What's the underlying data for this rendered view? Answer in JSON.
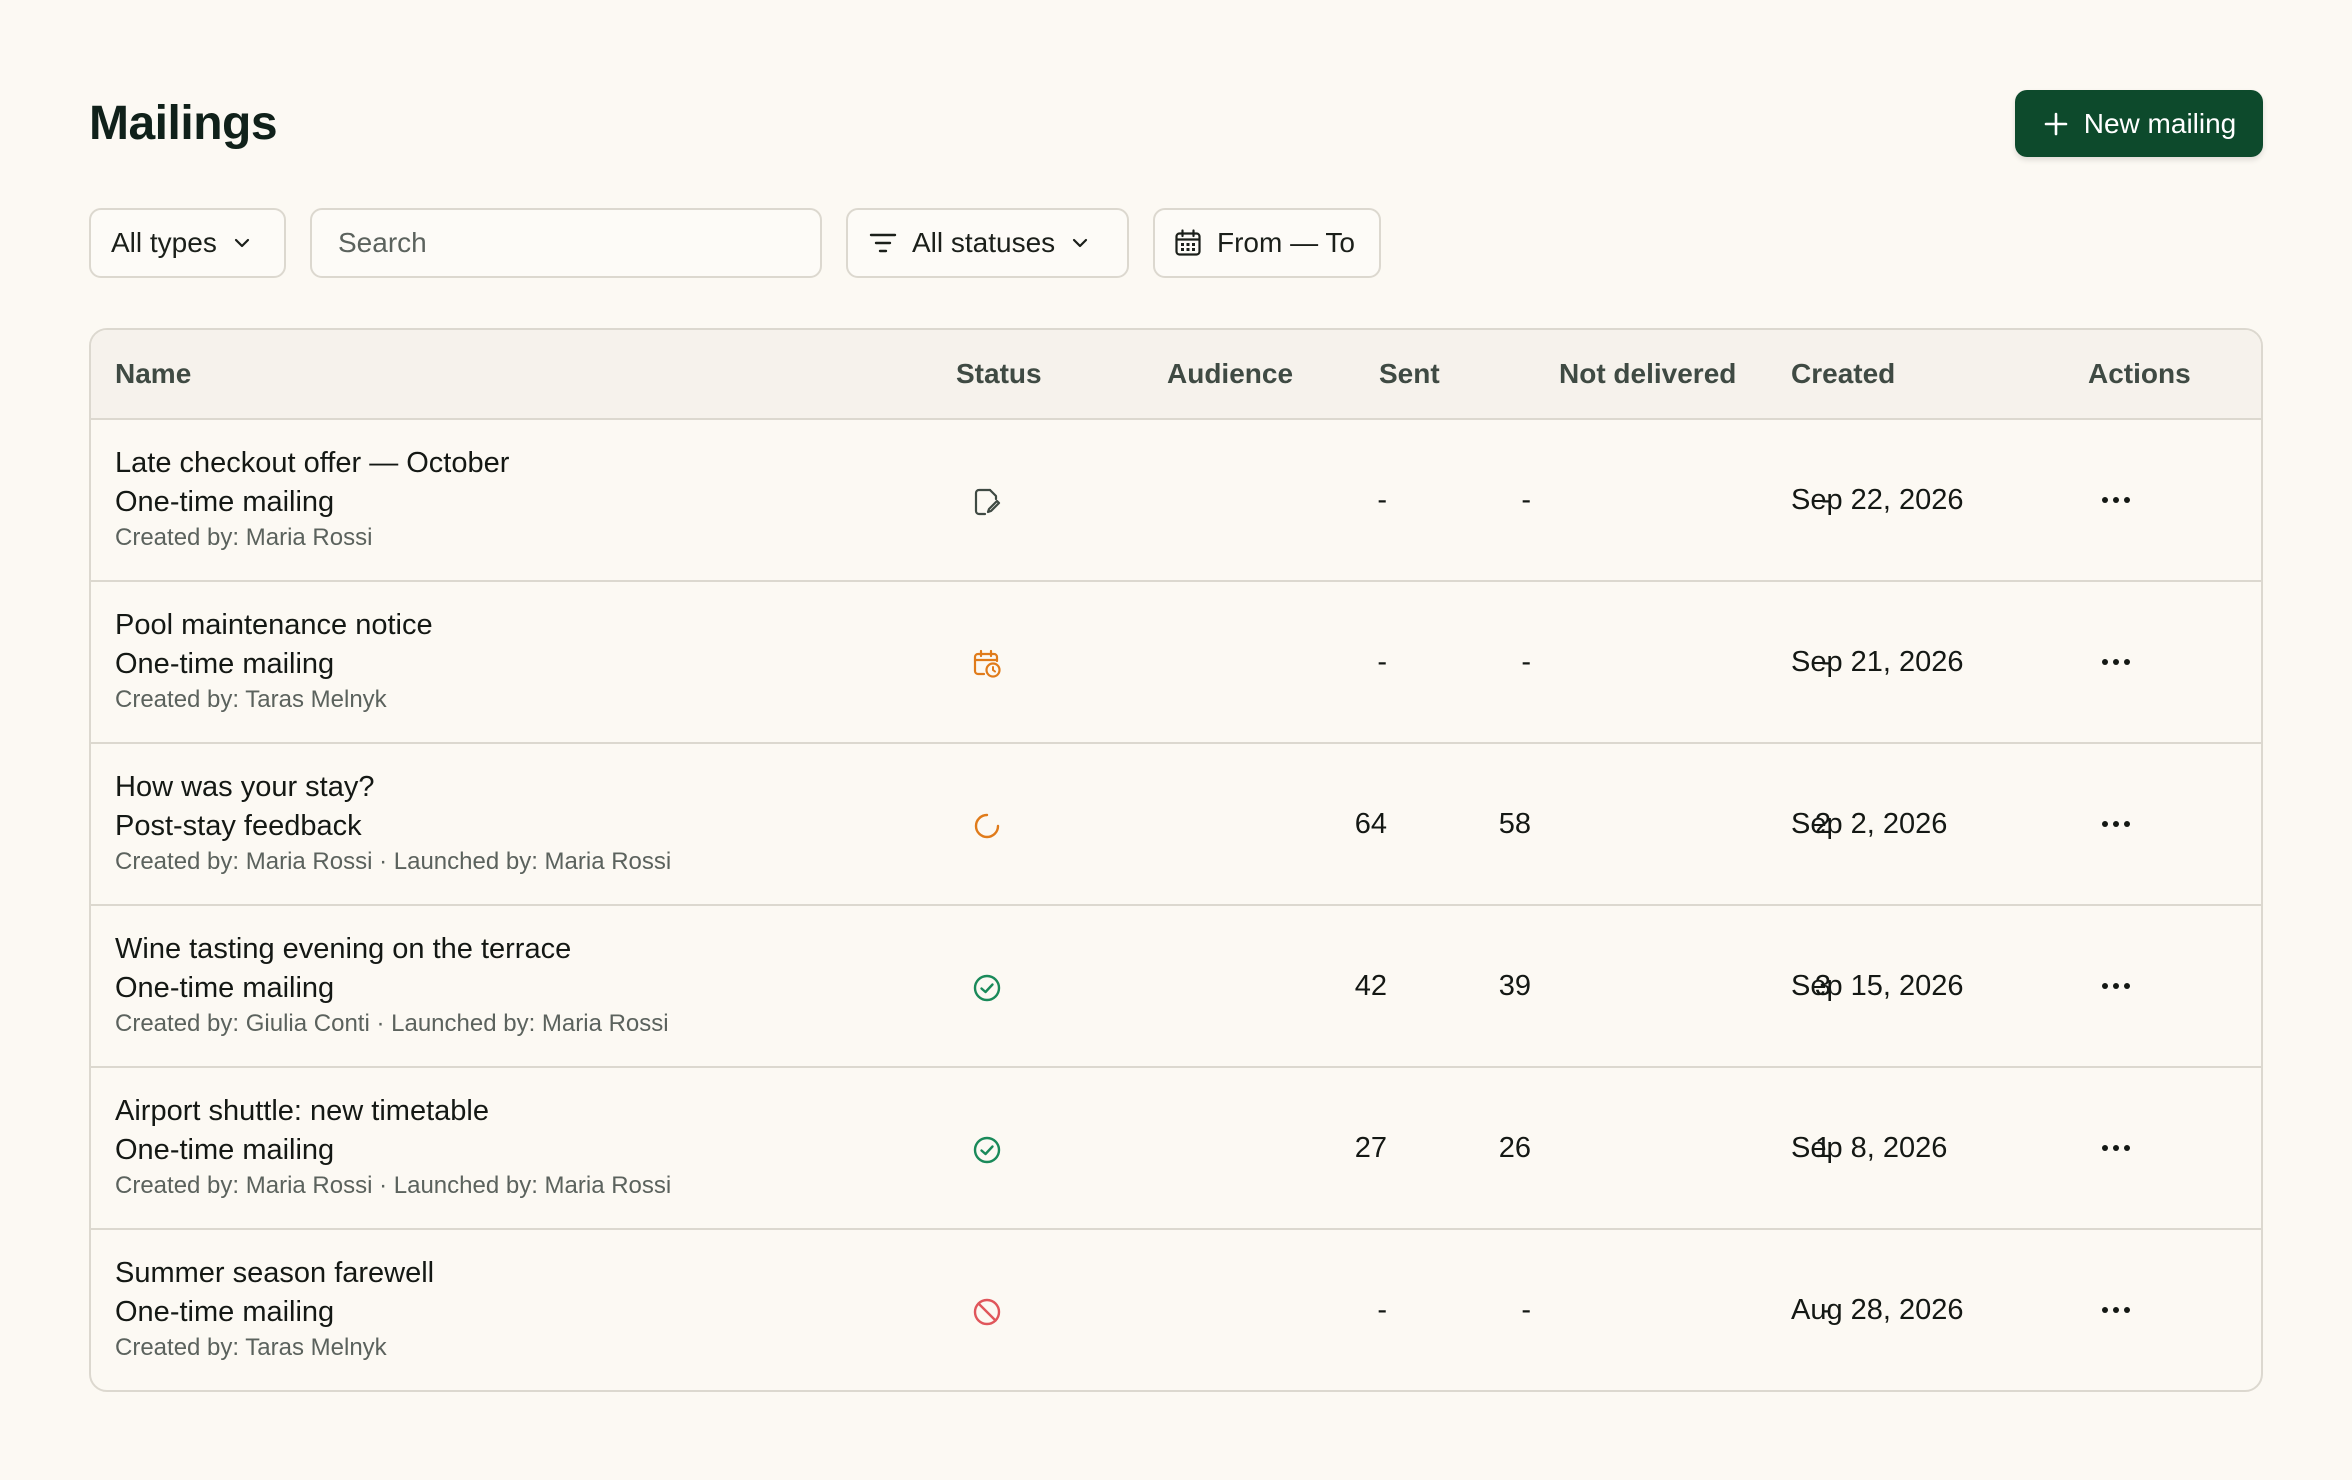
{
  "header": {
    "title": "Mailings",
    "new_button_label": "New mailing"
  },
  "filters": {
    "type_label": "All types",
    "search_placeholder": "Search",
    "search_value": "",
    "status_label": "All statuses",
    "date_label": "From — To"
  },
  "table": {
    "columns": {
      "name": "Name",
      "status": "Status",
      "audience": "Audience",
      "sent": "Sent",
      "not_delivered": "Not delivered",
      "created": "Created",
      "actions": "Actions"
    },
    "rows": [
      {
        "title": "Late checkout offer — October",
        "type": "One-time mailing",
        "meta": "Created by: Maria Rossi",
        "status_icon": "draft-icon",
        "audience": "-",
        "sent": "-",
        "not_delivered": "-",
        "created": "Sep 22, 2026"
      },
      {
        "title": "Pool maintenance notice",
        "type": "One-time mailing",
        "meta": "Created by: Taras Melnyk",
        "status_icon": "scheduled-icon",
        "audience": "-",
        "sent": "-",
        "not_delivered": "-",
        "created": "Sep 21, 2026"
      },
      {
        "title": "How was your stay?",
        "type": "Post-stay feedback",
        "meta": "Created by: Maria Rossi · Launched by: Maria Rossi",
        "status_icon": "in-progress-icon",
        "audience": "64",
        "sent": "58",
        "not_delivered": "2",
        "created": "Sep 2, 2026"
      },
      {
        "title": "Wine tasting evening on the terrace",
        "type": "One-time mailing",
        "meta": "Created by: Giulia Conti · Launched by: Maria Rossi",
        "status_icon": "completed-icon",
        "audience": "42",
        "sent": "39",
        "not_delivered": "3",
        "created": "Sep 15, 2026"
      },
      {
        "title": "Airport shuttle: new timetable",
        "type": "One-time mailing",
        "meta": "Created by: Maria Rossi · Launched by: Maria Rossi",
        "status_icon": "completed-icon",
        "audience": "27",
        "sent": "26",
        "not_delivered": "1",
        "created": "Sep 8, 2026"
      },
      {
        "title": "Summer season farewell",
        "type": "One-time mailing",
        "meta": "Created by: Taras Melnyk",
        "status_icon": "cancelled-icon",
        "audience": "-",
        "sent": "-",
        "not_delivered": "-",
        "created": "Aug 28, 2026"
      }
    ]
  },
  "colors": {
    "background": "#fcf9f3",
    "primary_button": "#0d4a2c",
    "border": "#dcd8cf",
    "header_bg": "#f6f2ec",
    "status_draft": "#3f4a43",
    "status_scheduled": "#e07b1a",
    "status_in_progress": "#e07b1a",
    "status_completed": "#1a8a5a",
    "status_cancelled": "#e0565b"
  }
}
